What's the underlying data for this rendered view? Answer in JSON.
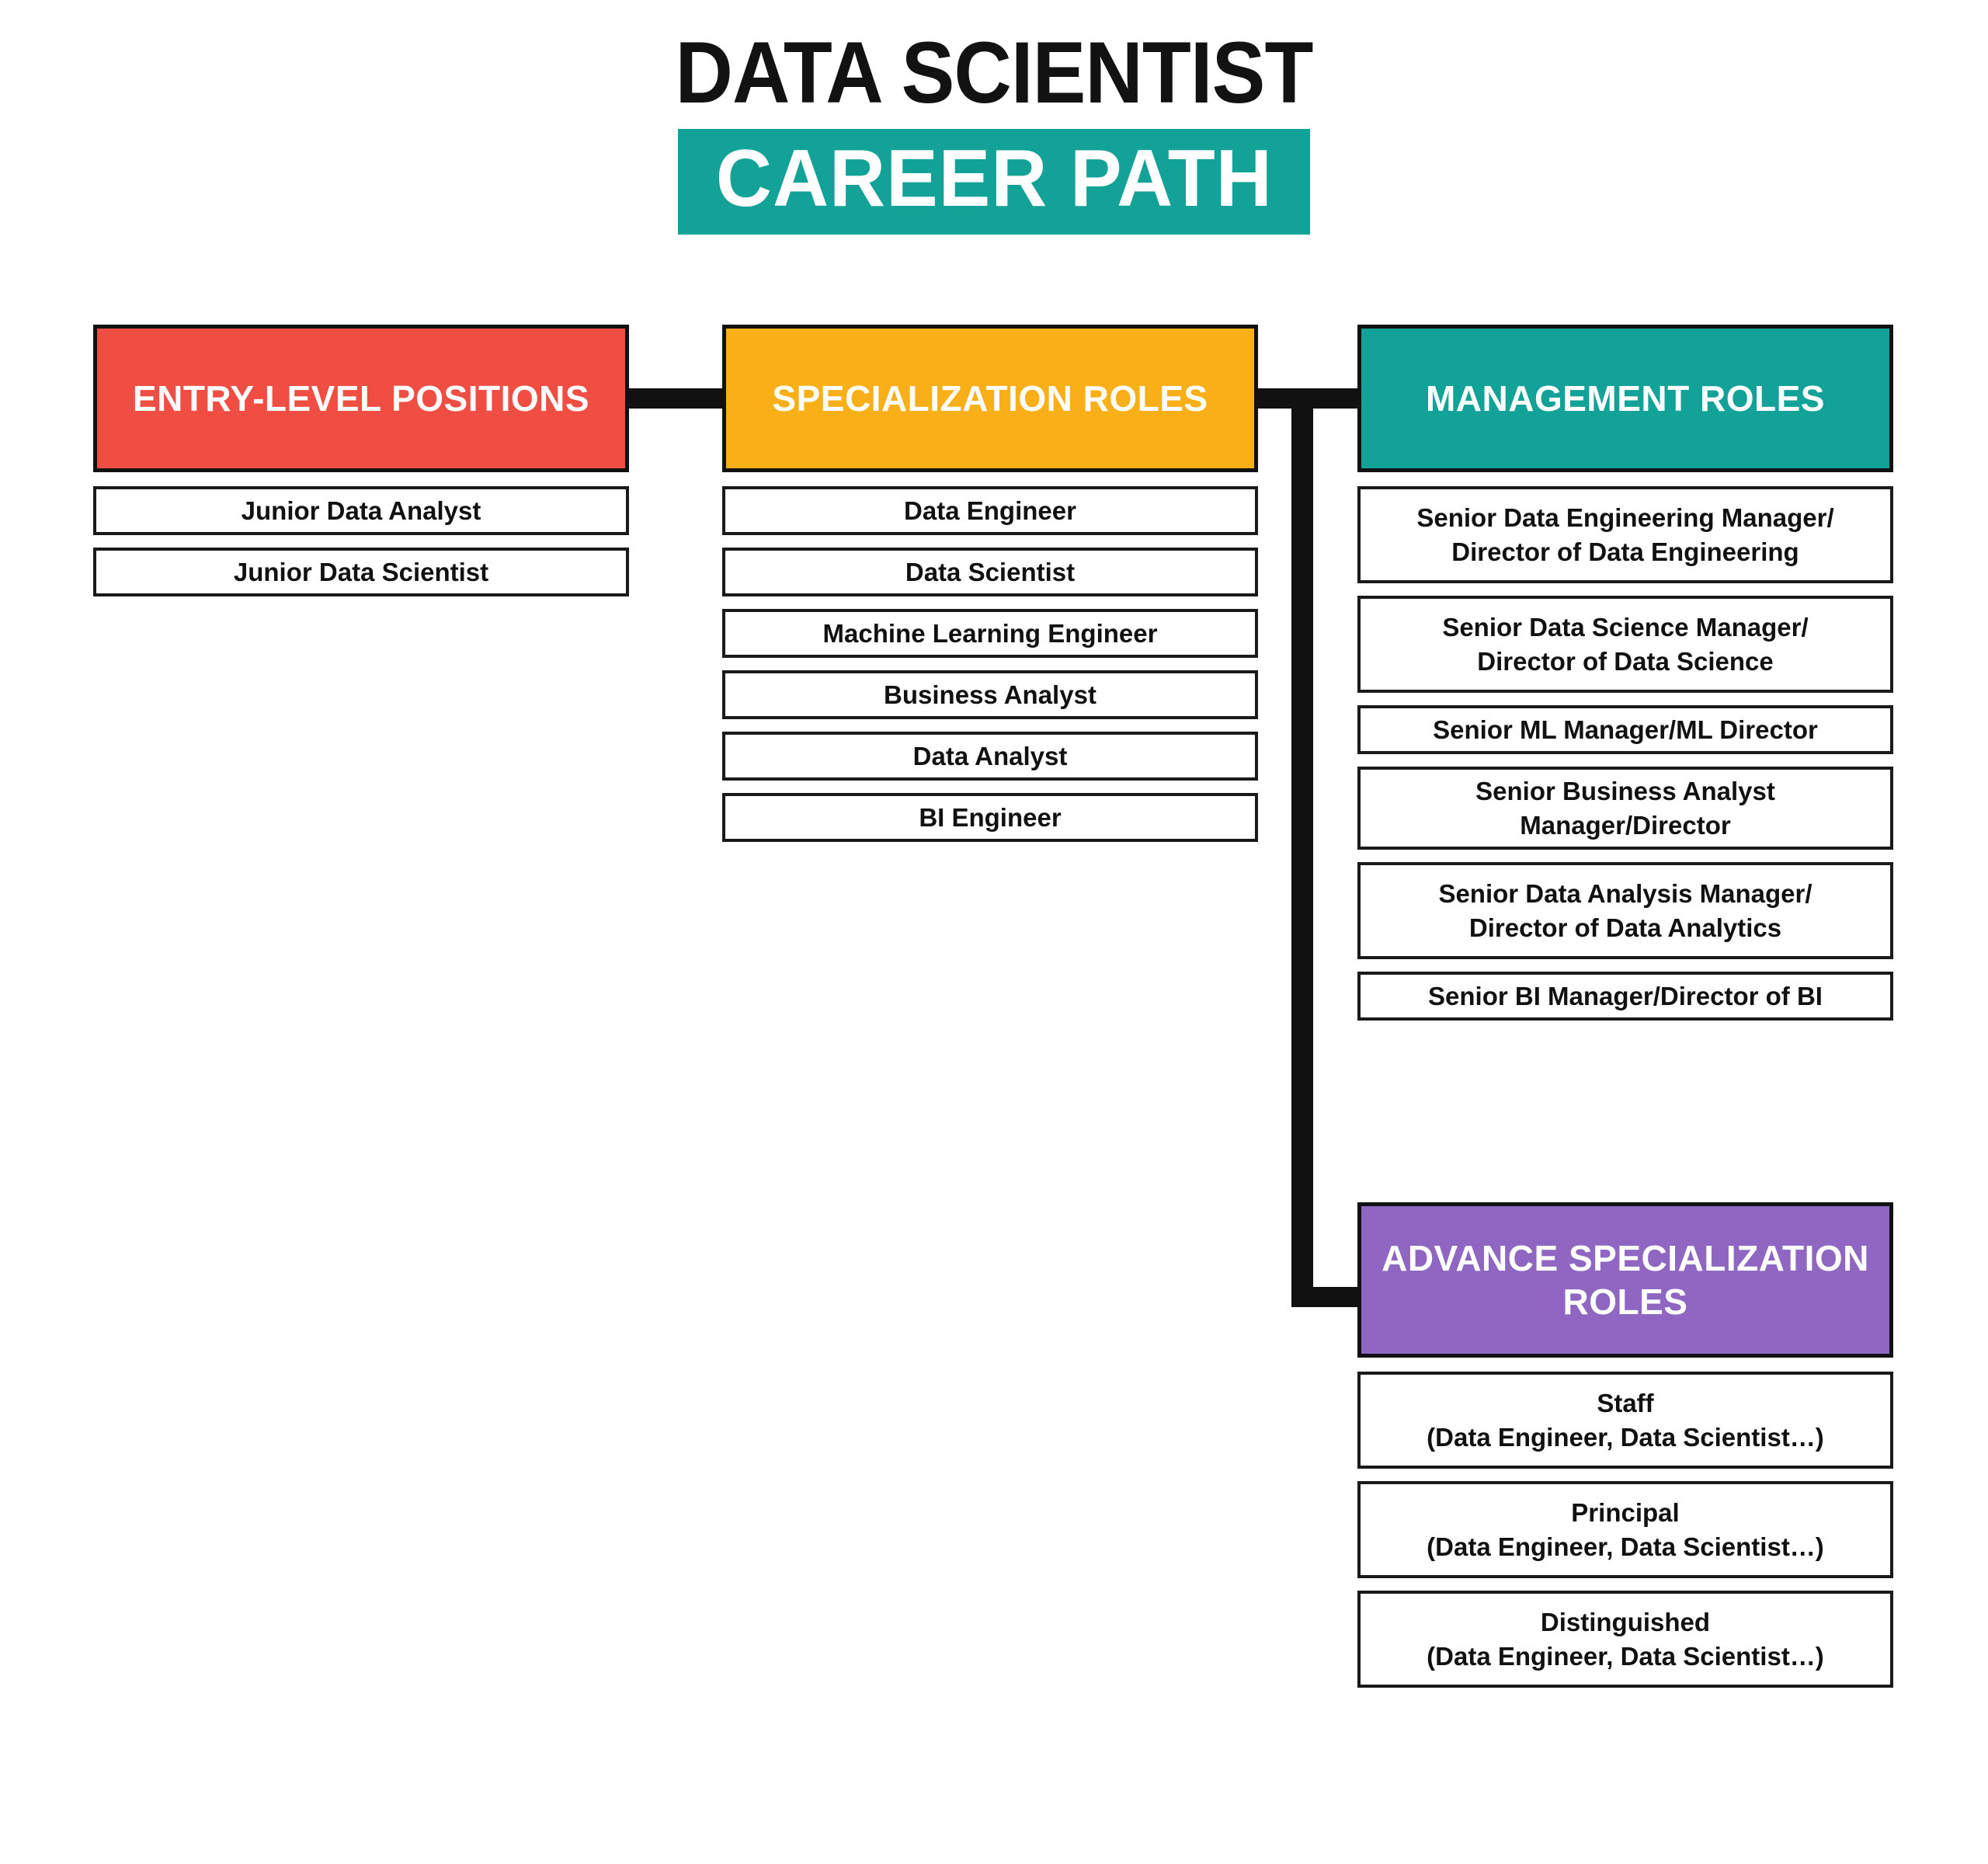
{
  "title": {
    "line1": "DATA SCIENTIST",
    "line2": "CAREER PATH",
    "highlight_color": "#13A297"
  },
  "colors": {
    "entry": "#F04E42",
    "specialization": "#F9AF18",
    "management": "#13A297",
    "advance": "#9066C3",
    "outline": "#111111",
    "background": "#FFFFFF"
  },
  "columns": {
    "entry": {
      "header": "ENTRY-LEVEL POSITIONS",
      "header_line1": "ENTRY-LEVEL",
      "header_line2": "POSITIONS",
      "items": [
        "Junior Data Analyst",
        "Junior Data Scientist"
      ]
    },
    "specialization": {
      "header": "SPECIALIZATION ROLES",
      "header_line1": "SPECIALIZATION",
      "header_line2": "ROLES",
      "items": [
        "Data Engineer",
        "Data Scientist",
        "Machine Learning Engineer",
        "Business Analyst",
        "Data Analyst",
        "BI Engineer"
      ]
    },
    "management": {
      "header": "MANAGEMENT ROLES",
      "header_line1": "MANAGEMENT",
      "header_line2": "ROLES",
      "items": [
        {
          "line1": "Senior Data Engineering Manager/",
          "line2": "Director of Data Engineering"
        },
        {
          "line1": "Senior Data Science Manager/",
          "line2": "Director of Data Science"
        },
        {
          "line1": "Senior ML Manager/ML Director",
          "line2": ""
        },
        {
          "line1": "Senior Business Analyst",
          "line2": "Manager/Director"
        },
        {
          "line1": "Senior Data Analysis Manager/",
          "line2": "Director of Data Analytics"
        },
        {
          "line1": "Senior BI Manager/Director of BI",
          "line2": ""
        }
      ]
    },
    "advance": {
      "header": "ADVANCE SPECIALIZATION ROLES",
      "header_line1": "ADVANCE",
      "header_line2": "SPECIALIZATION",
      "header_line3": "ROLES",
      "items": [
        {
          "line1": "Staff",
          "line2": "(Data Engineer, Data Scientist…)"
        },
        {
          "line1": "Principal",
          "line2": "(Data Engineer, Data Scientist…)"
        },
        {
          "line1": "Distinguished",
          "line2": "(Data Engineer, Data Scientist…)"
        }
      ]
    }
  },
  "flow": {
    "entry_to_specialization": "arrow-right",
    "specialization_to_management": "arrow-right",
    "specialization_to_advance": "arrow-down-right"
  }
}
